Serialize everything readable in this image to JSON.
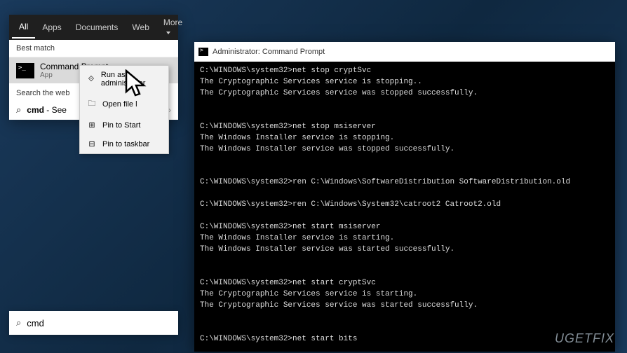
{
  "search": {
    "tabs": [
      "All",
      "Apps",
      "Documents",
      "Web",
      "More"
    ],
    "best_match_label": "Best match",
    "result": {
      "title": "Command Prompt",
      "subtitle": "App"
    },
    "search_web_label": "Search the web",
    "web_result_prefix": "cmd",
    "web_result_suffix": " - See",
    "input_value": "cmd"
  },
  "context_menu": {
    "items": [
      {
        "icon": "admin-run-icon",
        "glyph": "⟐",
        "label": "Run as administrator"
      },
      {
        "icon": "folder-icon",
        "glyph": "🗀",
        "label": "Open file l"
      },
      {
        "icon": "pin-start-icon",
        "glyph": "⊞",
        "label": "Pin to Start"
      },
      {
        "icon": "pin-taskbar-icon",
        "glyph": "⊟",
        "label": "Pin to taskbar"
      }
    ]
  },
  "cmd": {
    "title": "Administrator: Command Prompt",
    "lines": [
      "C:\\WINDOWS\\system32>net stop cryptSvc",
      "The Cryptographic Services service is stopping..",
      "The Cryptographic Services service was stopped successfully.",
      "",
      "",
      "C:\\WINDOWS\\system32>net stop msiserver",
      "The Windows Installer service is stopping.",
      "The Windows Installer service was stopped successfully.",
      "",
      "",
      "C:\\WINDOWS\\system32>ren C:\\Windows\\SoftwareDistribution SoftwareDistribution.old",
      "",
      "C:\\WINDOWS\\system32>ren C:\\Windows\\System32\\catroot2 Catroot2.old",
      "",
      "C:\\WINDOWS\\system32>net start msiserver",
      "The Windows Installer service is starting.",
      "The Windows Installer service was started successfully.",
      "",
      "",
      "C:\\WINDOWS\\system32>net start cryptSvc",
      "The Cryptographic Services service is starting.",
      "The Cryptographic Services service was started successfully.",
      "",
      "",
      "C:\\WINDOWS\\system32>net start bits"
    ]
  },
  "watermark": "UGETFIX"
}
